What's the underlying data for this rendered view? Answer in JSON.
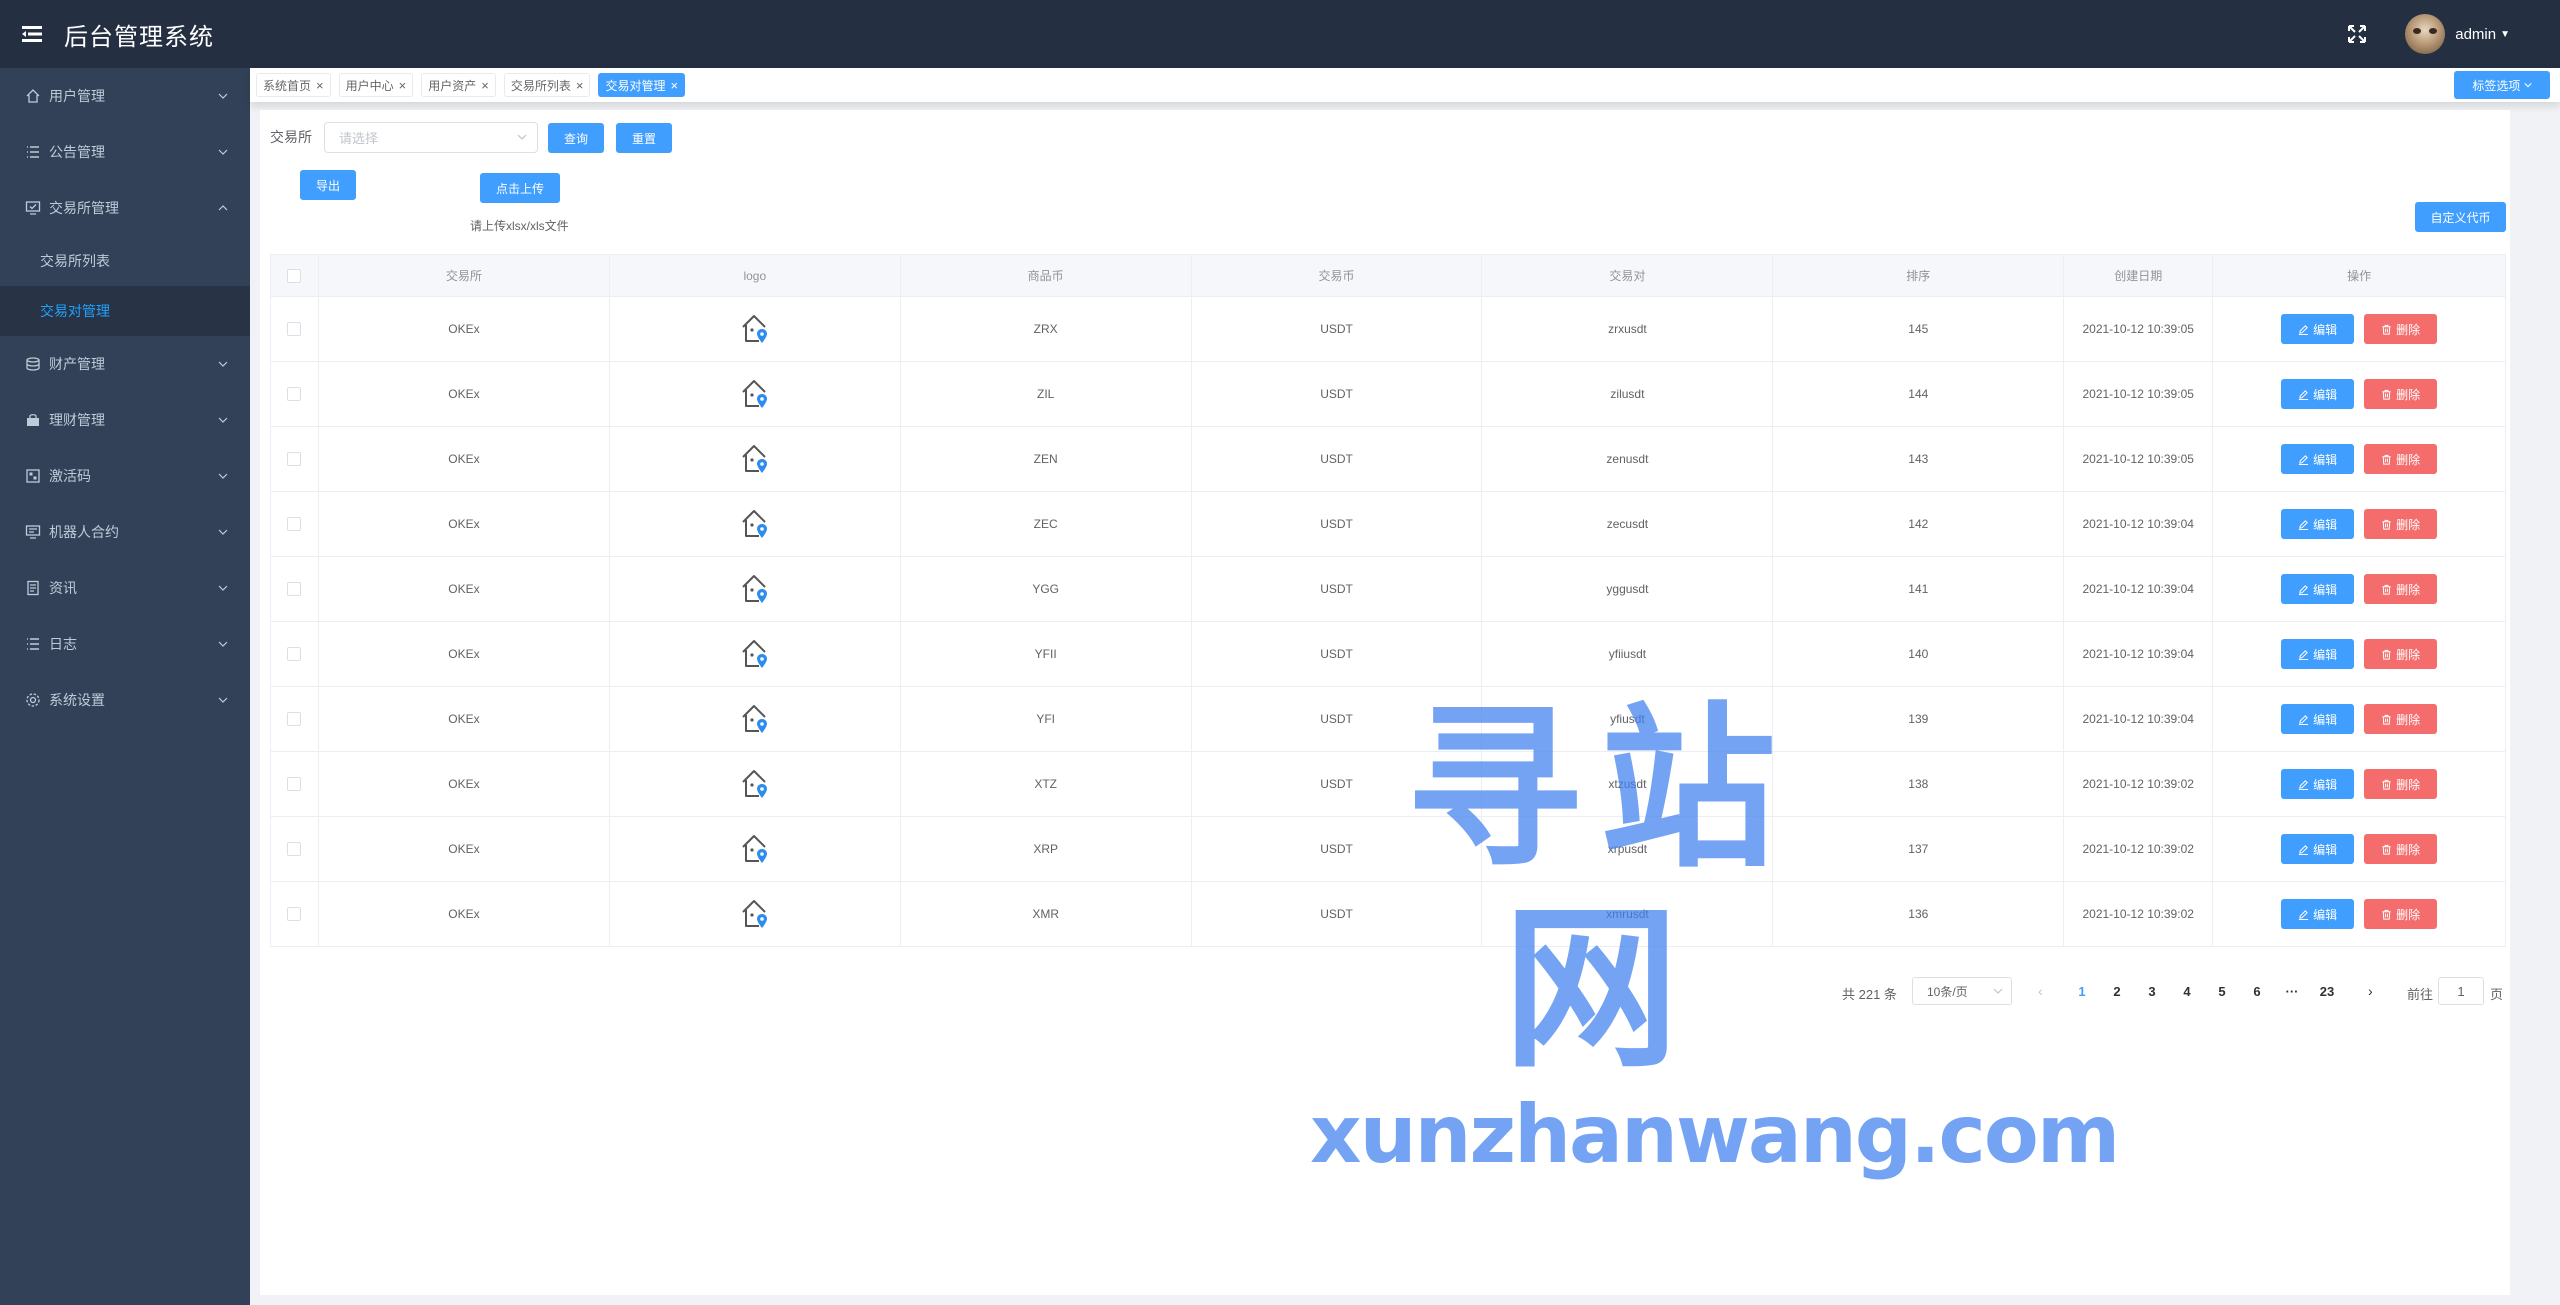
{
  "header": {
    "title": "后台管理系统",
    "username": "admin"
  },
  "sidebar": {
    "items": [
      {
        "label": "用户管理",
        "icon": "home-icon"
      },
      {
        "label": "公告管理",
        "icon": "list-icon"
      },
      {
        "label": "交易所管理",
        "icon": "monitor-check-icon",
        "expanded": true,
        "children": [
          {
            "label": "交易所列表",
            "active": false
          },
          {
            "label": "交易对管理",
            "active": true
          }
        ]
      },
      {
        "label": "财产管理",
        "icon": "coins-icon"
      },
      {
        "label": "理财管理",
        "icon": "bag-icon"
      },
      {
        "label": "激活码",
        "icon": "qr-icon"
      },
      {
        "label": "机器人合约",
        "icon": "robot-icon"
      },
      {
        "label": "资讯",
        "icon": "document-icon"
      },
      {
        "label": "日志",
        "icon": "log-icon"
      },
      {
        "label": "系统设置",
        "icon": "gear-icon"
      }
    ]
  },
  "tags": {
    "items": [
      {
        "label": "系统首页",
        "active": false
      },
      {
        "label": "用户中心",
        "active": false
      },
      {
        "label": "用户资产",
        "active": false
      },
      {
        "label": "交易所列表",
        "active": false
      },
      {
        "label": "交易对管理",
        "active": true
      }
    ],
    "options_label": "标签选项"
  },
  "filter": {
    "label": "交易所",
    "placeholder": "请选择",
    "search_label": "查询",
    "reset_label": "重置"
  },
  "toolbar": {
    "export_label": "导出",
    "upload_label": "点击上传",
    "upload_tip": "请上传xlsx/xls文件",
    "custom_coin_label": "自定义代币"
  },
  "table": {
    "columns": [
      "交易所",
      "logo",
      "商品币",
      "交易币",
      "交易对",
      "排序",
      "创建日期",
      "操作"
    ],
    "edit_label": "编辑",
    "delete_label": "删除",
    "rows": [
      {
        "exchange": "OKEx",
        "base": "ZRX",
        "quote": "USDT",
        "pair": "zrxusdt",
        "sort": "145",
        "created": "2021-10-12 10:39:05"
      },
      {
        "exchange": "OKEx",
        "base": "ZIL",
        "quote": "USDT",
        "pair": "zilusdt",
        "sort": "144",
        "created": "2021-10-12 10:39:05"
      },
      {
        "exchange": "OKEx",
        "base": "ZEN",
        "quote": "USDT",
        "pair": "zenusdt",
        "sort": "143",
        "created": "2021-10-12 10:39:05"
      },
      {
        "exchange": "OKEx",
        "base": "ZEC",
        "quote": "USDT",
        "pair": "zecusdt",
        "sort": "142",
        "created": "2021-10-12 10:39:04"
      },
      {
        "exchange": "OKEx",
        "base": "YGG",
        "quote": "USDT",
        "pair": "yggusdt",
        "sort": "141",
        "created": "2021-10-12 10:39:04"
      },
      {
        "exchange": "OKEx",
        "base": "YFII",
        "quote": "USDT",
        "pair": "yfiiusdt",
        "sort": "140",
        "created": "2021-10-12 10:39:04"
      },
      {
        "exchange": "OKEx",
        "base": "YFI",
        "quote": "USDT",
        "pair": "yfiusdt",
        "sort": "139",
        "created": "2021-10-12 10:39:04"
      },
      {
        "exchange": "OKEx",
        "base": "XTZ",
        "quote": "USDT",
        "pair": "xtzusdt",
        "sort": "138",
        "created": "2021-10-12 10:39:02"
      },
      {
        "exchange": "OKEx",
        "base": "XRP",
        "quote": "USDT",
        "pair": "xrpusdt",
        "sort": "137",
        "created": "2021-10-12 10:39:02"
      },
      {
        "exchange": "OKEx",
        "base": "XMR",
        "quote": "USDT",
        "pair": "xmrusdt",
        "sort": "136",
        "created": "2021-10-12 10:39:02"
      }
    ]
  },
  "pagination": {
    "total_text": "共 221 条",
    "page_size": "10条/页",
    "pages": [
      "1",
      "2",
      "3",
      "4",
      "5",
      "6",
      "···",
      "23"
    ],
    "current": "1",
    "goto_label": "前往",
    "goto_value": "1",
    "goto_unit": "页"
  },
  "watermark": {
    "big": "寻站网",
    "small": "xunzhanwang.com"
  },
  "colors": {
    "header_bg": "#242f42",
    "sidebar_bg": "#324157",
    "primary": "#409eff",
    "danger": "#f56c6c",
    "active_menu_text": "#20a0ff"
  }
}
